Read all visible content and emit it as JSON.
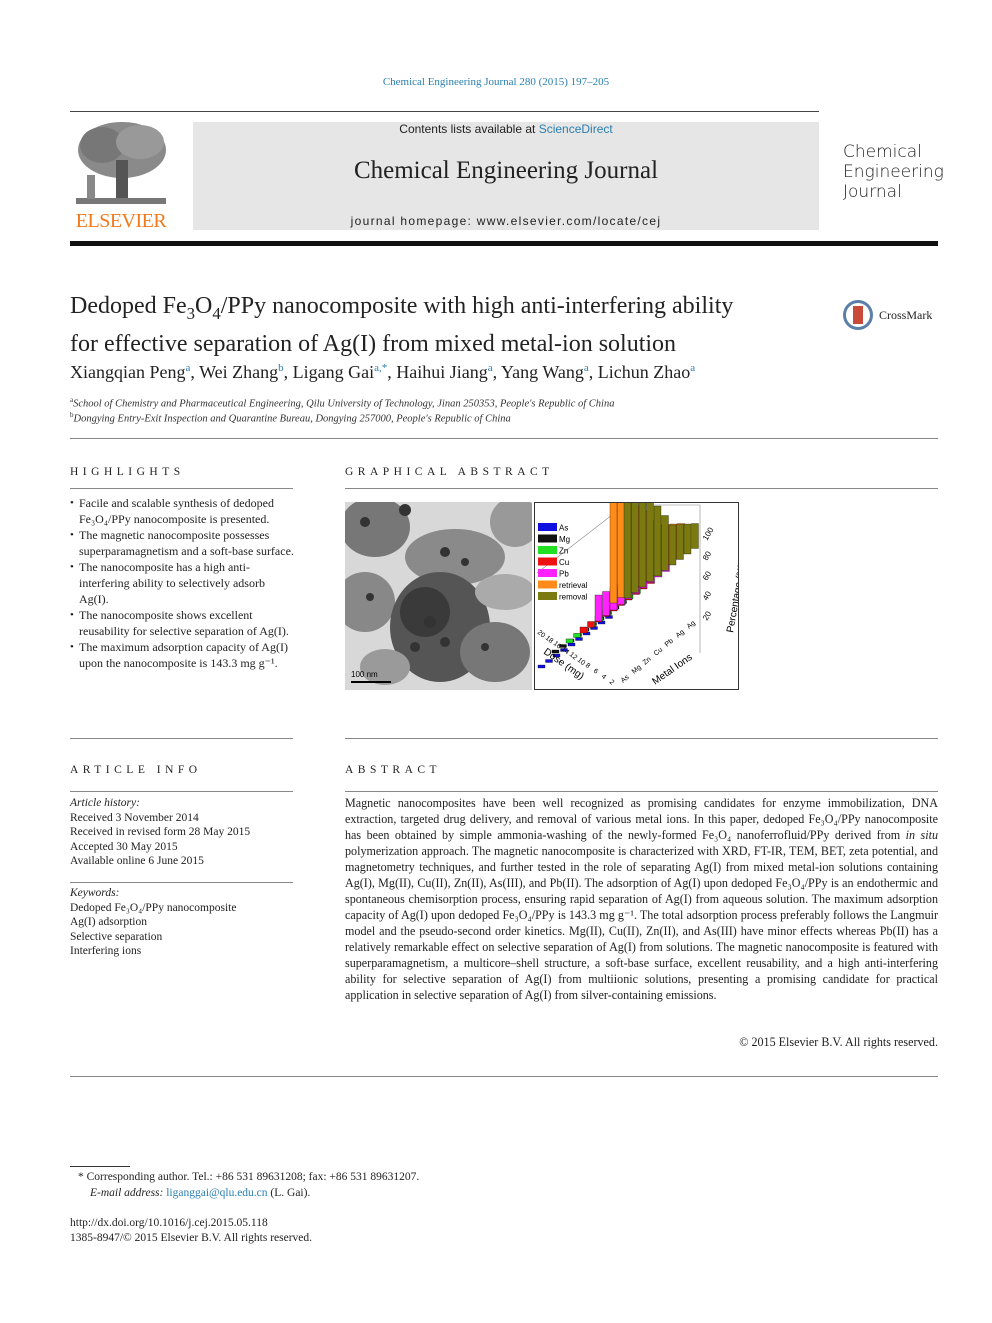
{
  "header": {
    "citation": "Chemical Engineering Journal 280 (2015) 197–205",
    "publisher_logo_text": "ELSEVIER",
    "contents_prefix": "Contents lists available at ",
    "contents_link": "ScienceDirect",
    "journal_title": "Chemical Engineering Journal",
    "homepage": "journal homepage: www.elsevier.com/locate/cej",
    "cover_lines": [
      "Chemical",
      "Engineering",
      "Journal"
    ]
  },
  "article": {
    "title_parts": {
      "a": "Dedoped Fe",
      "sub1": "3",
      "b": "O",
      "sub2": "4",
      "c": "/PPy nanocomposite with high anti-interfering ability",
      "line2": "for effective separation of Ag(I) from mixed metal-ion solution"
    },
    "crossmark_label": "CrossMark",
    "authors": [
      {
        "name": "Xiangqian Peng",
        "sup": "a",
        "sep": ", "
      },
      {
        "name": "Wei Zhang",
        "sup": "b",
        "sep": ", "
      },
      {
        "name": "Ligang Gai",
        "sup": "a,*",
        "sep": ", "
      },
      {
        "name": "Haihui Jiang",
        "sup": "a",
        "sep": ", "
      },
      {
        "name": "Yang Wang",
        "sup": "a",
        "sep": ", "
      },
      {
        "name": "Lichun Zhao",
        "sup": "a",
        "sep": ""
      }
    ],
    "affiliations": [
      {
        "mark": "a",
        "text": "School of Chemistry and Pharmaceutical Engineering, Qilu University of Technology, Jinan 250353, People's Republic of China"
      },
      {
        "mark": "b",
        "text": "Dongying Entry-Exit Inspection and Quarantine Bureau, Dongying 257000, People's Republic of China"
      }
    ]
  },
  "highlights": {
    "heading": "HIGHLIGHTS",
    "items": [
      "Facile and scalable synthesis of dedoped Fe₃O₄/PPy nanocomposite is presented.",
      "The magnetic nanocomposite possesses superparamagnetism and a soft-base surface.",
      "The nanocomposite has a high anti-interfering ability to selectively adsorb Ag(I).",
      "The nanocomposite shows excellent reusability for selective separation of Ag(I).",
      "The maximum adsorption capacity of Ag(I) upon the nanocomposite is 143.3 mg g⁻¹."
    ]
  },
  "graphical_abstract": {
    "heading": "GRAPHICAL ABSTRACT",
    "scale_bar": "100 nm",
    "chart": {
      "legend": [
        {
          "label": "As",
          "color": "#1010e0"
        },
        {
          "label": "Mg",
          "color": "#111111"
        },
        {
          "label": "Zn",
          "color": "#22e022"
        },
        {
          "label": "Cu",
          "color": "#ee1111"
        },
        {
          "label": "Pb",
          "color": "#ff22ff"
        },
        {
          "label": "retrieval",
          "color": "#ff8c1a"
        },
        {
          "label": "removal",
          "color": "#7a7a10"
        }
      ],
      "zlabel": "Percentage (%)",
      "xlabel": "Dose (mg)",
      "ylabel": "Metal Ions",
      "z_ticks": [
        "20",
        "40",
        "60",
        "80",
        "100"
      ],
      "ion_ticks": [
        "As",
        "Mg",
        "Zn",
        "Cu",
        "Pb",
        "Ag",
        "Ag"
      ],
      "dose_ticks": [
        "20",
        "18",
        "16",
        "14",
        "12",
        "10",
        "8",
        "6",
        "4",
        "2"
      ]
    }
  },
  "article_info": {
    "heading": "ARTICLE INFO",
    "history_label": "Article history:",
    "history": [
      "Received 3 November 2014",
      "Received in revised form 28 May 2015",
      "Accepted 30 May 2015",
      "Available online 6 June 2015"
    ],
    "keywords_label": "Keywords:",
    "keywords": [
      "Dedoped Fe₃O₄/PPy nanocomposite",
      "Ag(I) adsorption",
      "Selective separation",
      "Interfering ions"
    ]
  },
  "abstract": {
    "heading": "ABSTRACT",
    "text": "Magnetic nanocomposites have been well recognized as promising candidates for enzyme immobilization, DNA extraction, targeted drug delivery, and removal of various metal ions. In this paper, dedoped Fe₃O₄/PPy nanocomposite has been obtained by simple ammonia-washing of the newly-formed Fe₃O₄ nanoferrofluid/PPy derived from in situ polymerization approach. The magnetic nanocomposite is characterized with XRD, FT-IR, TEM, BET, zeta potential, and magnetometry techniques, and further tested in the role of separating Ag(I) from mixed metal-ion solutions containing Ag(I), Mg(II), Cu(II), Zn(II), As(III), and Pb(II). The adsorption of Ag(I) upon dedoped Fe₃O₄/PPy is an endothermic and spontaneous chemisorption process, ensuring rapid separation of Ag(I) from aqueous solution. The maximum adsorption capacity of Ag(I) upon dedoped Fe₃O₄/PPy is 143.3 mg g⁻¹. The total adsorption process preferably follows the Langmuir model and the pseudo-second order kinetics. Mg(II), Cu(II), Zn(II), and As(III) have minor effects whereas Pb(II) has a relatively remarkable effect on selective separation of Ag(I) from solutions. The magnetic nanocomposite is featured with superparamagnetism, a multicore–shell structure, a soft-base surface, excellent reusability, and a high anti-interfering ability for selective separation of Ag(I) from multiionic solutions, presenting a promising candidate for practical application in selective separation of Ag(I) from silver-containing emissions.",
    "copyright": "© 2015 Elsevier B.V. All rights reserved."
  },
  "footnotes": {
    "corresponding": "* Corresponding author. Tel.: +86 531 89631208; fax: +86 531 89631207.",
    "email_label": "E-mail address: ",
    "email": "liganggai@qlu.edu.cn",
    "email_suffix": " (L. Gai).",
    "doi": "http://dx.doi.org/10.1016/j.cej.2015.05.118",
    "issn": "1385-8947/© 2015 Elsevier B.V. All rights reserved."
  }
}
